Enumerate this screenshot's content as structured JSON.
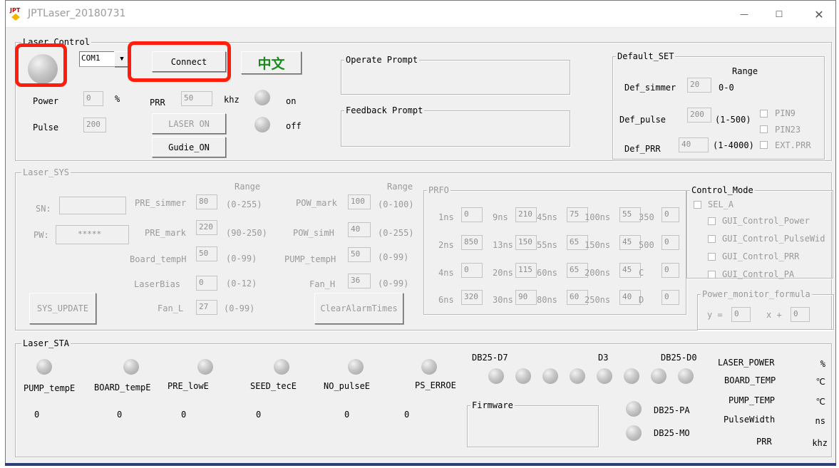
{
  "window": {
    "title": "JPTLaser_20180731",
    "minimize": "—",
    "maximize": "☐",
    "close": "✕"
  },
  "laser_control": {
    "title": "Laser Control",
    "com_port": "COM1",
    "connect_label": "Connect",
    "lang_label": "中文",
    "power_label": "Power",
    "power_value": "0",
    "power_unit": "%",
    "prr_label": "PRR",
    "prr_value": "50",
    "prr_unit": "khz",
    "pulse_label": "Pulse",
    "pulse_value": "200",
    "laser_on_label": "LASER ON",
    "guide_on_label": "Gudie_ON",
    "on_label": "on",
    "off_label": "off",
    "operate_prompt": "Operate Prompt",
    "feedback_prompt": "Feedback Prompt"
  },
  "default_set": {
    "title": "Default_SET",
    "range_label": "Range",
    "simmer_label": "Def_simmer",
    "simmer_value": "20",
    "simmer_range": "0-0",
    "pulse_label": "Def_pulse",
    "pulse_value": "200",
    "pulse_range": "(1-500)",
    "prr_label": "Def_PRR",
    "prr_value": "40",
    "prr_range": "(1-4000)",
    "pin9": "PIN9",
    "pin23": "PIN23",
    "ext_prr": "EXT.PRR"
  },
  "laser_sys": {
    "title": "Laser_SYS",
    "sn_label": "SN:",
    "sn_value": "",
    "pw_label": "PW:",
    "pw_value": "*****",
    "range_label_1": "Range",
    "range_label_2": "Range",
    "pre_simmer_label": "PRE_simmer",
    "pre_simmer_value": "80",
    "pre_simmer_range": "(0-255)",
    "pre_mark_label": "PRE_mark",
    "pre_mark_value": "220",
    "pre_mark_range": "(90-250)",
    "board_temph_label": "Board_tempH",
    "board_temph_value": "50",
    "board_temph_range": "(0-99)",
    "laser_bias_label": "LaserBias",
    "laser_bias_value": "0",
    "laser_bias_range": "(0-12)",
    "fan_l_label": "Fan_L",
    "fan_l_value": "27",
    "fan_l_range": "(0-99)",
    "pow_mark_label": "POW_mark",
    "pow_mark_value": "100",
    "pow_mark_range": "(0-100)",
    "pow_simh_label": "POW_simH",
    "pow_simh_value": "40",
    "pow_simh_range": "(0-255)",
    "pump_temph_label": "PUMP_tempH",
    "pump_temph_value": "50",
    "pump_temph_range": "(0-99)",
    "fan_h_label": "Fan_H",
    "fan_h_value": "36",
    "fan_h_range": "(0-99)",
    "sys_update_label": "SYS_UPDATE",
    "clear_alarm_label": "ClearAlarmTimes"
  },
  "prfo": {
    "title": "PRFO",
    "cells": [
      {
        "label": "1ns",
        "value": "0"
      },
      {
        "label": "9ns",
        "value": "210"
      },
      {
        "label": "45ns",
        "value": "75"
      },
      {
        "label": "100ns",
        "value": "55"
      },
      {
        "label": "350",
        "value": "0"
      },
      {
        "label": "2ns",
        "value": "850"
      },
      {
        "label": "13ns",
        "value": "150"
      },
      {
        "label": "55ns",
        "value": "65"
      },
      {
        "label": "150ns",
        "value": "45"
      },
      {
        "label": "500",
        "value": "0"
      },
      {
        "label": "4ns",
        "value": "0"
      },
      {
        "label": "20ns",
        "value": "115"
      },
      {
        "label": "60ns",
        "value": "65"
      },
      {
        "label": "200ns",
        "value": "45"
      },
      {
        "label": "C",
        "value": "0"
      },
      {
        "label": "6ns",
        "value": "320"
      },
      {
        "label": "30ns",
        "value": "90"
      },
      {
        "label": "80ns",
        "value": "60"
      },
      {
        "label": "250ns",
        "value": "40"
      },
      {
        "label": "D",
        "value": "0"
      }
    ]
  },
  "control_mode": {
    "title": "Control_Mode",
    "sel_a": "SEL_A",
    "options": [
      "GUI_Control_Power",
      "GUI_Control_PulseWid",
      "GUI_Control_PRR",
      "GUI_Control_PA"
    ],
    "formula_title": "Power_monitor_formula",
    "y_label": "y =",
    "y_value": "0",
    "x_label": "x +",
    "x_value": "0"
  },
  "laser_sta": {
    "title": "Laser_STA",
    "indicators": [
      {
        "label": "PUMP_tempE",
        "value": "0"
      },
      {
        "label": "BOARD_tempE",
        "value": "0"
      },
      {
        "label": "PRE_lowE",
        "value": "0"
      },
      {
        "label": "SEED_tecE",
        "value": "0"
      },
      {
        "label": "NO_pulseE",
        "value": "0"
      },
      {
        "label": "PS_ERROE",
        "value": "0"
      }
    ],
    "db25_d7": "DB25-D7",
    "d3": "D3",
    "db25_d0": "DB25-D0",
    "firmware": "Firmware",
    "db25_pa": "DB25-PA",
    "db25_mo": "DB25-MO",
    "status_rows": [
      {
        "label": "LASER_POWER",
        "unit": "%"
      },
      {
        "label": "BOARD_TEMP",
        "unit": "℃"
      },
      {
        "label": "PUMP_TEMP",
        "unit": "℃"
      },
      {
        "label": "PulseWidth",
        "unit": "ns"
      },
      {
        "label": "PRR",
        "unit": "khz"
      }
    ]
  },
  "colors": {
    "highlight": "#ff1d0d",
    "lang_text": "#1a8a1a",
    "taskbar": "#2f3e7a"
  }
}
